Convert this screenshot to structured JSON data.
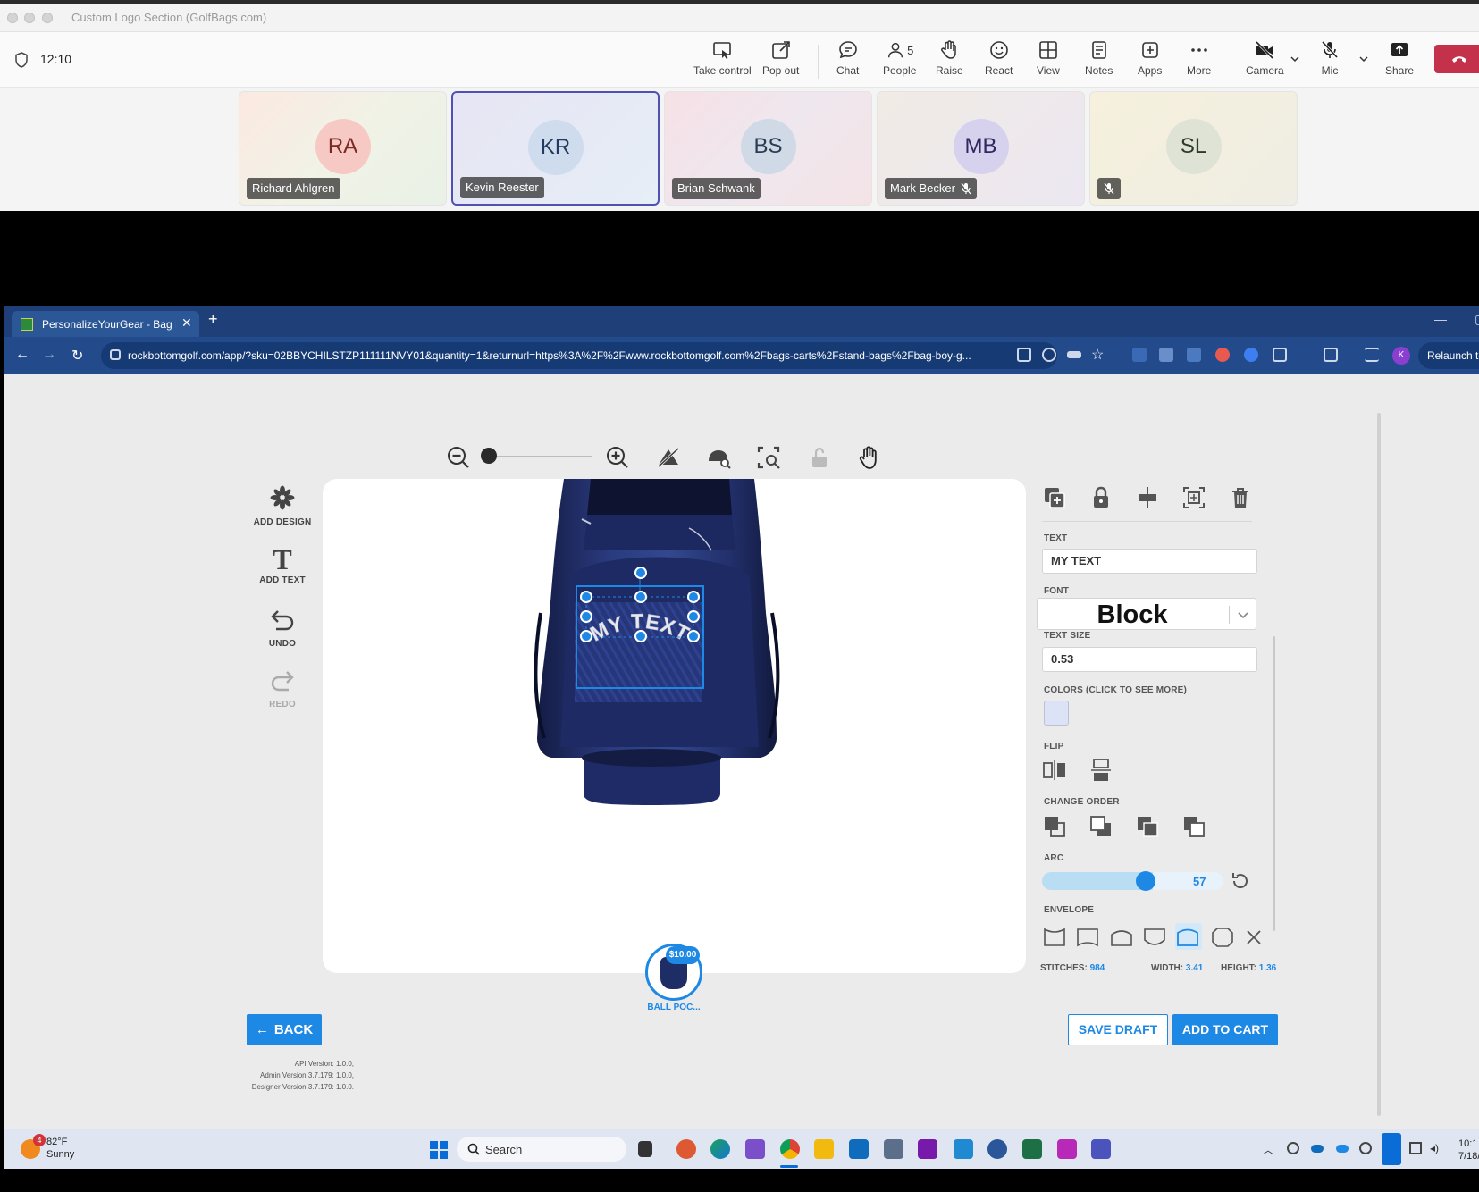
{
  "window": {
    "title": "Custom Logo Section (GolfBags.com)"
  },
  "meeting": {
    "time": "12:10",
    "toolbar": [
      {
        "label": "Take control",
        "icon": "take-control-icon"
      },
      {
        "label": "Pop out",
        "icon": "pop-out-icon"
      },
      {
        "label": "Chat",
        "icon": "chat-icon"
      },
      {
        "label": "People",
        "icon": "people-icon",
        "count": "5"
      },
      {
        "label": "Raise",
        "icon": "raise-hand-icon"
      },
      {
        "label": "React",
        "icon": "react-icon"
      },
      {
        "label": "View",
        "icon": "view-icon"
      },
      {
        "label": "Notes",
        "icon": "notes-icon"
      },
      {
        "label": "Apps",
        "icon": "apps-icon"
      },
      {
        "label": "More",
        "icon": "more-icon"
      },
      {
        "label": "Camera",
        "icon": "camera-off-icon"
      },
      {
        "label": "Mic",
        "icon": "mic-off-icon"
      },
      {
        "label": "Share",
        "icon": "share-icon"
      }
    ],
    "leave_color": "#c4314b",
    "participants": [
      {
        "initials": "RA",
        "name": "Richard Ahlgren",
        "muted": false,
        "active": false,
        "bg": "#f7c9c4",
        "fg": "#7a2a22"
      },
      {
        "initials": "KR",
        "name": "Kevin Reester",
        "muted": false,
        "active": true,
        "bg": "#cfdcee",
        "fg": "#233a5f"
      },
      {
        "initials": "BS",
        "name": "Brian Schwank",
        "muted": false,
        "active": false,
        "bg": "#cfdae6",
        "fg": "#2b3c52"
      },
      {
        "initials": "MB",
        "name": "Mark Becker",
        "muted": true,
        "active": false,
        "bg": "#d6d2ee",
        "fg": "#30285e"
      },
      {
        "initials": "SL",
        "name": "",
        "muted": true,
        "active": false,
        "bg": "#dfe3d6",
        "fg": "#2f3a2a"
      }
    ]
  },
  "browser": {
    "tab_title": "PersonalizeYourGear - Bag Boy",
    "url": "rockbottomgolf.com/app/?sku=02BBYCHILSTZP111111NVY01&quantity=1&returnurl=https%3A%2F%2Fwww.rockbottomgolf.com%2Fbags-carts%2Fstand-bags%2Fbag-boy-g...",
    "profile_initial": "K",
    "relaunch_label": "Relaunch to u"
  },
  "designer": {
    "left_nav": [
      {
        "label": "ADD DESIGN",
        "icon": "add-design-icon",
        "enabled": true
      },
      {
        "label": "ADD TEXT",
        "icon": "add-text-icon",
        "enabled": true
      },
      {
        "label": "UNDO",
        "icon": "undo-icon",
        "enabled": true
      },
      {
        "label": "REDO",
        "icon": "redo-icon",
        "enabled": false
      }
    ],
    "zoom_level": 0,
    "canvas_text": "MY TEXT",
    "panel": {
      "text_label": "TEXT",
      "text_value": "MY TEXT",
      "font_label": "FONT",
      "font_value": "Block",
      "size_label": "TEXT SIZE",
      "size_value": "0.53",
      "colors_label": "COLORS (CLICK TO SEE MORE)",
      "color_value": "#dde3f6",
      "flip_label": "FLIP",
      "order_label": "CHANGE ORDER",
      "arc_label": "ARC",
      "arc_value": "57",
      "envelope_label": "ENVELOPE",
      "stitches_label": "STITCHES:",
      "stitches_value": "984",
      "width_label": "WIDTH:",
      "width_value": "3.41",
      "height_label": "HEIGHT:",
      "height_value": "1.36"
    },
    "ball_pocket": {
      "price": "$10.00",
      "label": "BALL POC..."
    },
    "buttons": {
      "back": "BACK",
      "save_draft": "SAVE DRAFT",
      "add_to_cart": "ADD TO CART"
    },
    "versions": [
      "API Version: 1.0.0,",
      "Admin Version 3.7.179: 1.0.0,",
      "Designer Version 3.7.179: 1.0.0."
    ],
    "accent": "#1e88e5"
  },
  "taskbar": {
    "weather_badge": "4",
    "temperature": "82°F",
    "condition": "Sunny",
    "search_label": "Search",
    "clock_time": "10:1",
    "clock_date": "7/18/"
  }
}
